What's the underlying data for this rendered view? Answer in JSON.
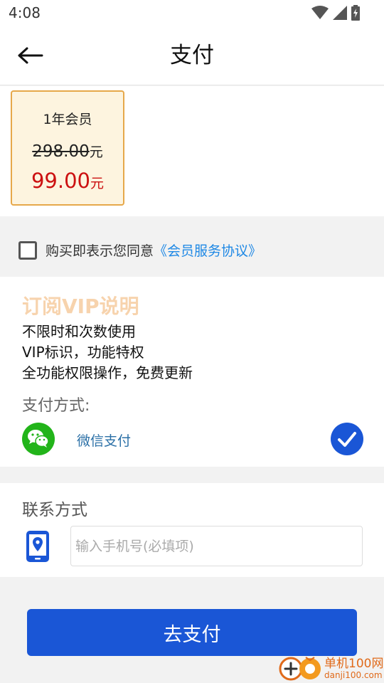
{
  "status_bar": {
    "time": "4:08",
    "icons": [
      "wifi-icon",
      "signal-icon",
      "battery-charging-icon"
    ]
  },
  "header": {
    "title": "支付",
    "back_icon": "back-arrow-icon"
  },
  "plan": {
    "name": "1年会员",
    "original_price": "298.00",
    "original_unit": "元",
    "price": "99.00",
    "price_unit": "元"
  },
  "agreement": {
    "checked": false,
    "text": "购买即表示您同意",
    "link": "《会员服务协议》"
  },
  "vip_info": {
    "title": "订阅VIP说明",
    "features": [
      "不限时和次数使用",
      "VIP标识，功能特权",
      "全功能权限操作，免费更新"
    ]
  },
  "payment": {
    "label": "支付方式:",
    "method": "微信支付",
    "selected": true
  },
  "contact": {
    "label": "联系方式",
    "phone_placeholder": "输入手机号(必填项)",
    "phone_value": ""
  },
  "pay_button": {
    "label": "去支付"
  },
  "watermark": {
    "site_name": "单机100网",
    "url": "danji100.com"
  },
  "colors": {
    "primary": "#1a56d6",
    "price_red": "#cc1111",
    "card_border": "#e6a84a",
    "card_bg": "#fdf4df",
    "vip_title": "#f7d3ad",
    "link": "#1e88e5",
    "wechat_green": "#22b41a"
  }
}
